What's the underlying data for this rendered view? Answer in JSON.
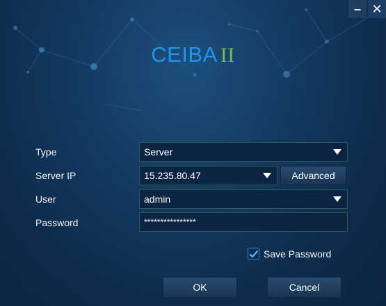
{
  "window": {
    "minimize_glyph": "–",
    "close_glyph": "✕"
  },
  "logo": {
    "brand": "CEIBA",
    "version": "II"
  },
  "form": {
    "type": {
      "label": "Type",
      "value": "Server"
    },
    "server_ip": {
      "label": "Server IP",
      "value": "15.235.80.47",
      "advanced_label": "Advanced"
    },
    "user": {
      "label": "User",
      "value": "admin"
    },
    "password": {
      "label": "Password",
      "value": "****************"
    }
  },
  "save_password": {
    "label": "Save Password",
    "checked": true
  },
  "buttons": {
    "ok": "OK",
    "cancel": "Cancel"
  },
  "colors": {
    "brand_blue": "#1e96ef",
    "brand_green": "#6dc04a",
    "background": "#133a61"
  },
  "icons": [
    "minimize-icon",
    "close-icon",
    "dropdown-arrow-icon",
    "checkmark-icon"
  ]
}
